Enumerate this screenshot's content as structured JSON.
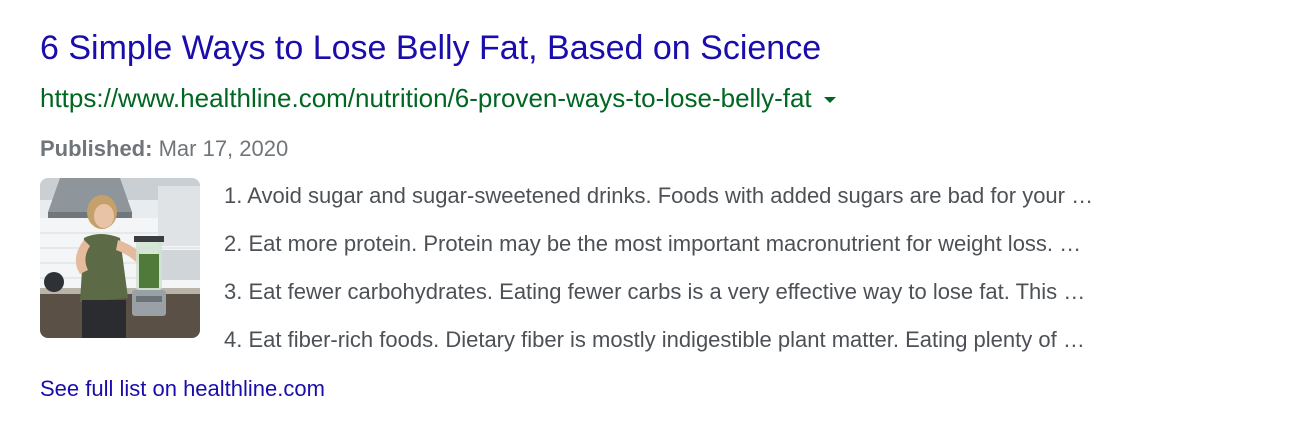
{
  "result": {
    "title": "6 Simple Ways to Lose Belly Fat, Based on Science",
    "url": "https://www.healthline.com/nutrition/6-proven-ways-to-lose-belly-fat",
    "url_menu_icon": "caret-down-icon",
    "published_label": "Published:",
    "published_date": "Mar 17, 2020",
    "thumbnail_subject": "woman-with-blender-image",
    "list_items": [
      "1. Avoid sugar and sugar-sweetened drinks. Foods with added sugars are bad for your …",
      "2. Eat more protein. Protein may be the most important macronutrient for weight loss. …",
      "3. Eat fewer carbohydrates. Eating fewer carbs is a very effective way to lose fat. This …",
      "4. Eat fiber-rich foods. Dietary fiber is mostly indigestible plant matter. Eating plenty of …"
    ],
    "see_more": "See full list on healthline.com"
  },
  "colors": {
    "title": "#1a0dab",
    "url": "#006621",
    "meta": "#70757a",
    "snippet": "#4d5156"
  }
}
